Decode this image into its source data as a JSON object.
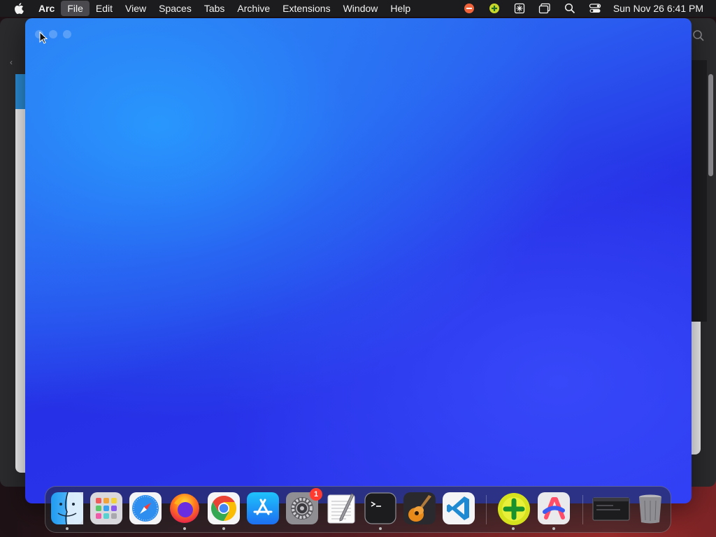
{
  "menubar": {
    "app_name": "Arc",
    "menus": [
      "File",
      "Edit",
      "View",
      "Spaces",
      "Tabs",
      "Archive",
      "Extensions",
      "Window",
      "Help"
    ],
    "active_menu": "File",
    "status_icons": [
      "record-stop-icon",
      "add-plus-circle-icon",
      "game-controller-icon",
      "window-mirroring-icon",
      "spotlight-search-icon",
      "control-center-icon"
    ],
    "clock": "Sun Nov 26  6:41 PM"
  },
  "arc_window": {
    "traffic_lights": [
      "close",
      "minimize",
      "maximize"
    ]
  },
  "dock": {
    "apps": [
      {
        "name": "Finder",
        "icon": "finder-icon",
        "running": true
      },
      {
        "name": "Launchpad",
        "icon": "launchpad-icon",
        "running": false
      },
      {
        "name": "Safari",
        "icon": "safari-icon",
        "running": false
      },
      {
        "name": "Firefox",
        "icon": "firefox-icon",
        "running": true
      },
      {
        "name": "Google Chrome",
        "icon": "chrome-icon",
        "running": true
      },
      {
        "name": "App Store",
        "icon": "app-store-icon",
        "running": false
      },
      {
        "name": "System Settings",
        "icon": "system-settings-icon",
        "running": false,
        "badge": "1"
      },
      {
        "name": "TextEdit",
        "icon": "textedit-icon",
        "running": false
      },
      {
        "name": "Terminal",
        "icon": "terminal-icon",
        "running": true
      },
      {
        "name": "GarageBand",
        "icon": "garageband-icon",
        "running": false
      },
      {
        "name": "Visual Studio Code",
        "icon": "vscode-icon",
        "running": false
      },
      {
        "name": "Add App",
        "icon": "add-plus-icon",
        "running": true
      },
      {
        "name": "Arc",
        "icon": "arc-icon",
        "running": true
      },
      {
        "name": "Window Preview",
        "icon": "window-thumbnail-icon",
        "running": false
      },
      {
        "name": "Trash",
        "icon": "trash-icon",
        "running": false
      }
    ]
  },
  "colors": {
    "menubar_bg": "#1c1c1e",
    "arc_gradient_light": "#2f8ff5",
    "arc_gradient_deep": "#2630e6",
    "badge_red": "#ff3b30"
  }
}
